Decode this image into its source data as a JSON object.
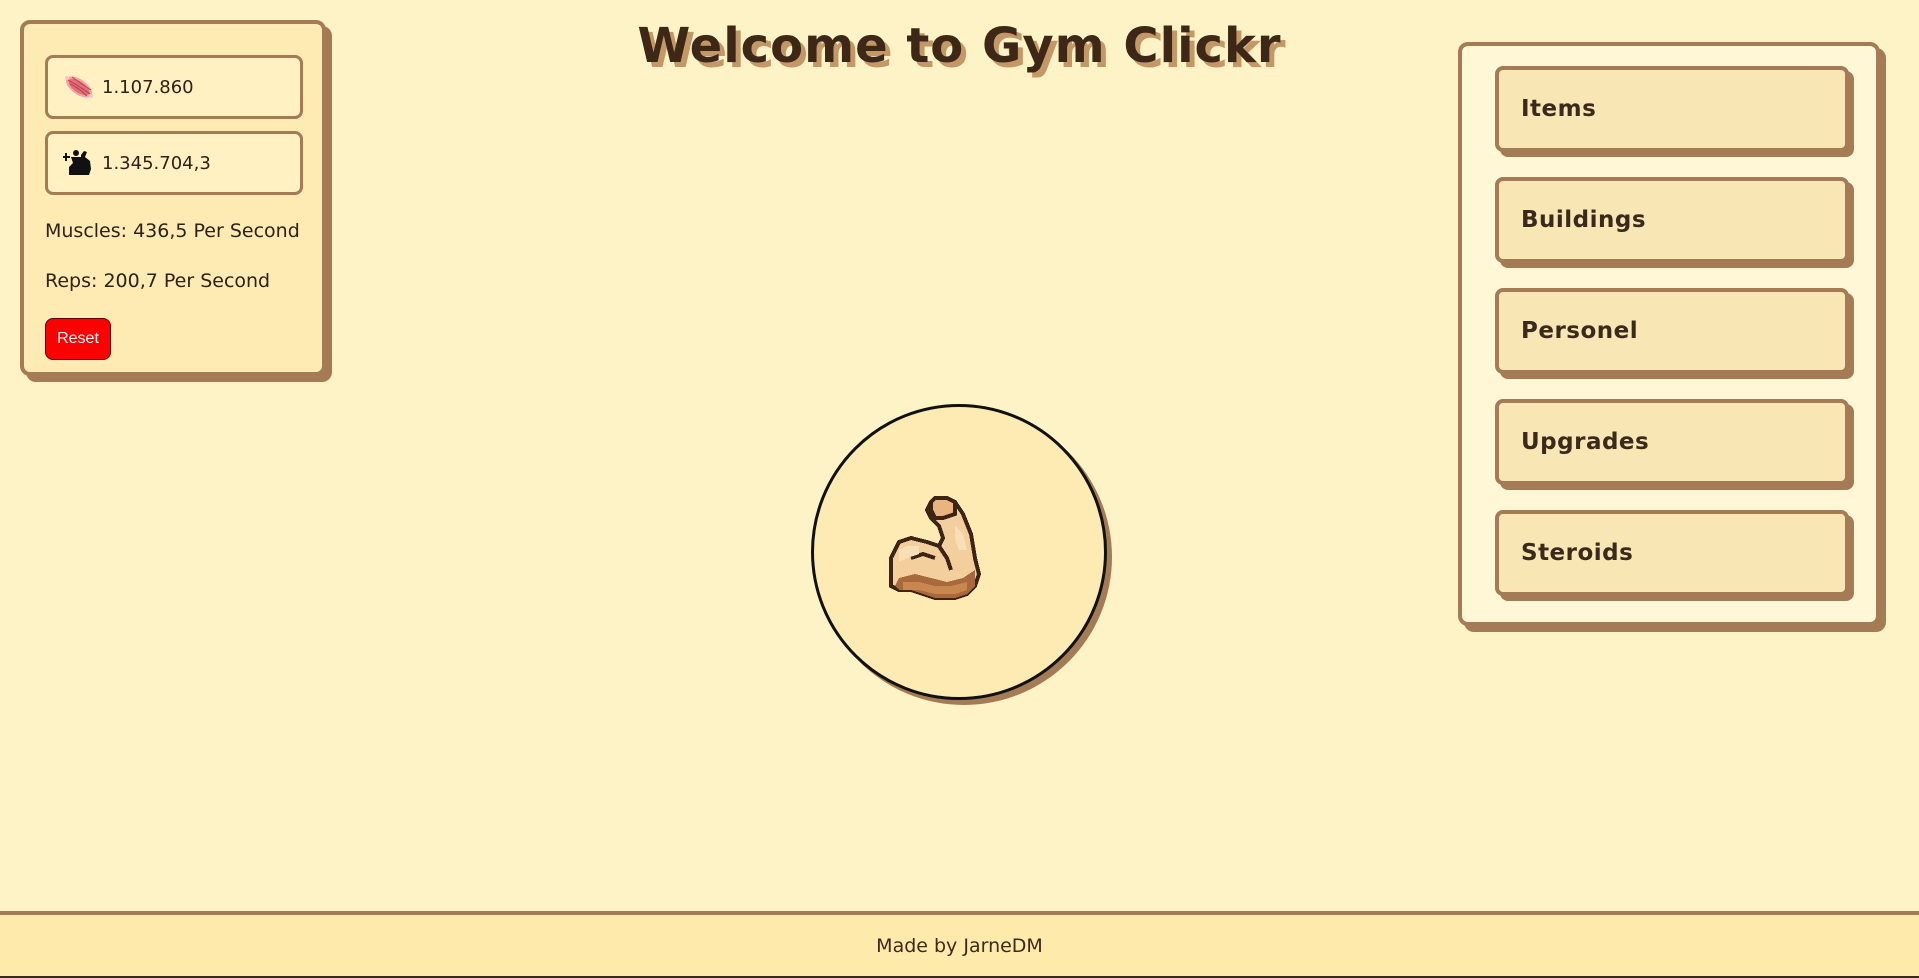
{
  "title": "Welcome to Gym Clickr",
  "stats": {
    "muscles_icon": "muscle-fiber-icon",
    "muscles_count": "1.107.860",
    "reps_icon": "flexing-bodybuilder-icon",
    "reps_count": "1.345.704,3",
    "muscles_rate": "Muscles: 436,5 Per Second",
    "reps_rate": "Reps: 200,7 Per Second",
    "reset_label": "Reset"
  },
  "clicker": {
    "icon": "flexed-bicep-icon"
  },
  "menu": {
    "items": [
      {
        "label": "Items"
      },
      {
        "label": "Buildings"
      },
      {
        "label": "Personel"
      },
      {
        "label": "Upgrades"
      },
      {
        "label": "Steroids"
      }
    ]
  },
  "footer": {
    "text": "Made by JarneDM"
  },
  "colors": {
    "background": "#fef3c6",
    "panel": "#feebb4",
    "border": "#a47b55",
    "text": "#3b2a1c",
    "reset": "#ff0000"
  }
}
